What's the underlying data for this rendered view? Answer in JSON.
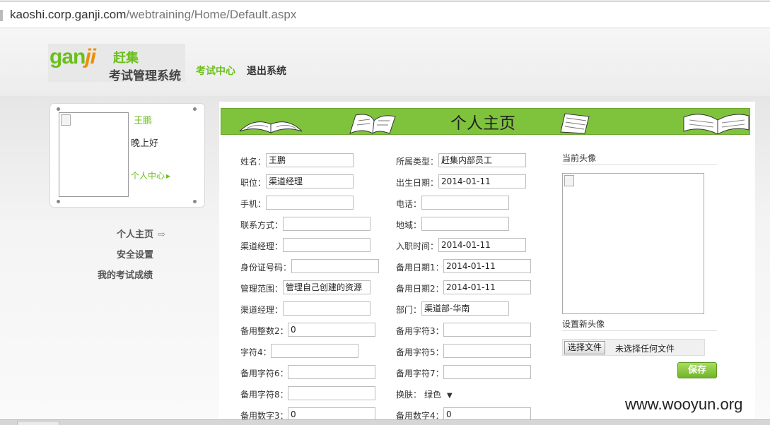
{
  "browser": {
    "url_host": "kaoshi.corp.ganji.com",
    "url_path": "/webtraining/Home/Default.aspx"
  },
  "header": {
    "logo_ganji": "gan",
    "logo_ji": "ji",
    "logo_cn": "赶集",
    "logo_system": "考试管理系统",
    "nav": [
      {
        "label": "考试中心",
        "active": true
      },
      {
        "label": "退出系统",
        "active": false
      }
    ],
    "brand_color": "#6bbf1c"
  },
  "user_card": {
    "name": "王鹏",
    "greeting": "晚上好",
    "center_link": "个人中心",
    "center_arrow": "▸"
  },
  "sidebar": {
    "items": [
      {
        "label": "个人主页",
        "active": true
      },
      {
        "label": "安全设置"
      },
      {
        "label": "我的考试成绩"
      }
    ],
    "arrow": "⇨"
  },
  "banner": {
    "title": "个人主页"
  },
  "form": {
    "left": [
      {
        "label": "姓名：",
        "value": "王鹏"
      },
      {
        "label": "职位：",
        "value": "渠道经理"
      },
      {
        "label": "手机：",
        "value": ""
      },
      {
        "label": "联系方式：",
        "value": ""
      },
      {
        "label": "渠道经理：",
        "value": ""
      },
      {
        "label": "身份证号码：",
        "value": ""
      },
      {
        "label": "管理范围：",
        "value": "管理自己创建的资源"
      },
      {
        "label": "渠道经理：",
        "value": ""
      },
      {
        "label": "备用整数2：",
        "value": "0"
      },
      {
        "label": "字符4：",
        "value": ""
      },
      {
        "label": "备用字符6：",
        "value": ""
      },
      {
        "label": "备用字符8：",
        "value": ""
      },
      {
        "label": "备用数字3：",
        "value": "0"
      }
    ],
    "right": [
      {
        "label": "所属类型：",
        "value": "赶集内部员工"
      },
      {
        "label": "出生日期：",
        "value": "2014-01-11"
      },
      {
        "label": "电话：",
        "value": ""
      },
      {
        "label": "地域：",
        "value": ""
      },
      {
        "label": "入职时间：",
        "value": "2014-01-11"
      },
      {
        "label": "备用日期1：",
        "value": "2014-01-11"
      },
      {
        "label": "备用日期2：",
        "value": "2014-01-11"
      },
      {
        "label": "部门：",
        "value": "渠道部-华南"
      },
      {
        "label": "备用字符3：",
        "value": ""
      },
      {
        "label": "备用字符5：",
        "value": ""
      },
      {
        "label": "备用字符7：",
        "value": ""
      },
      {
        "label": "换肤：",
        "value": "绿色",
        "type": "select"
      },
      {
        "label": "备用数字4：",
        "value": "0"
      }
    ]
  },
  "avatar_panel": {
    "current_title": "当前头像",
    "new_title": "设置新头像",
    "file_button": "选择文件",
    "file_status": "未选择任何文件",
    "save": "保存"
  },
  "watermark": "www.wooyun.org"
}
